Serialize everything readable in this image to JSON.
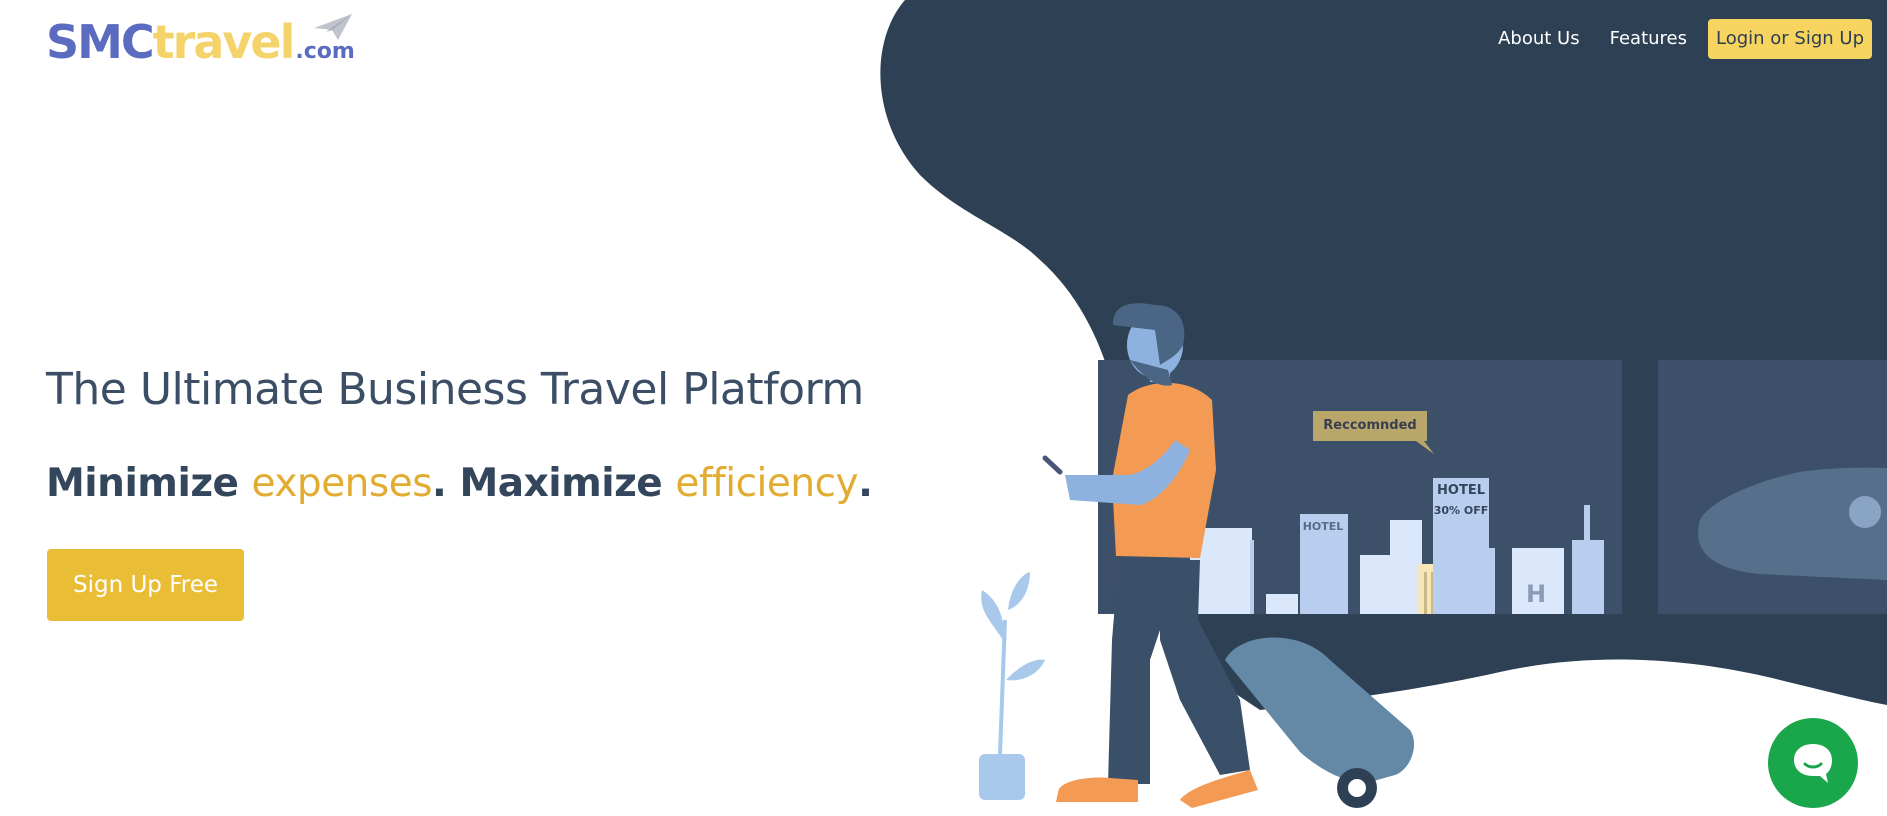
{
  "brand": {
    "logo_smc": "SMC",
    "logo_travel": "travel",
    "logo_tld": ".com",
    "colors": {
      "primary_blue": "#5b6bbf",
      "logo_yellow": "#f5d36b",
      "dark_navy": "#2e4054",
      "accent_gold": "#e2ac32",
      "cta_yellow": "#f6d45f",
      "chat_green": "#1aa64b"
    }
  },
  "nav": {
    "about": "About Us",
    "features": "Features",
    "login": "Login or Sign Up"
  },
  "hero": {
    "title": "The Ultimate Business Travel Platform",
    "sub_part1": "Minimize ",
    "sub_accent1": "expenses",
    "sub_part2": ". Maximize ",
    "sub_accent2": "efficiency",
    "sub_part3": ".",
    "cta": "Sign Up Free"
  },
  "illustration": {
    "tooltip": "Reccomnded",
    "hotel_big": "HOTEL",
    "hotel_discount": "30% OFF",
    "hotel_small": "HOTEL",
    "hotel_sign": "H"
  },
  "chat": {
    "icon": "chat-bubble-icon"
  }
}
